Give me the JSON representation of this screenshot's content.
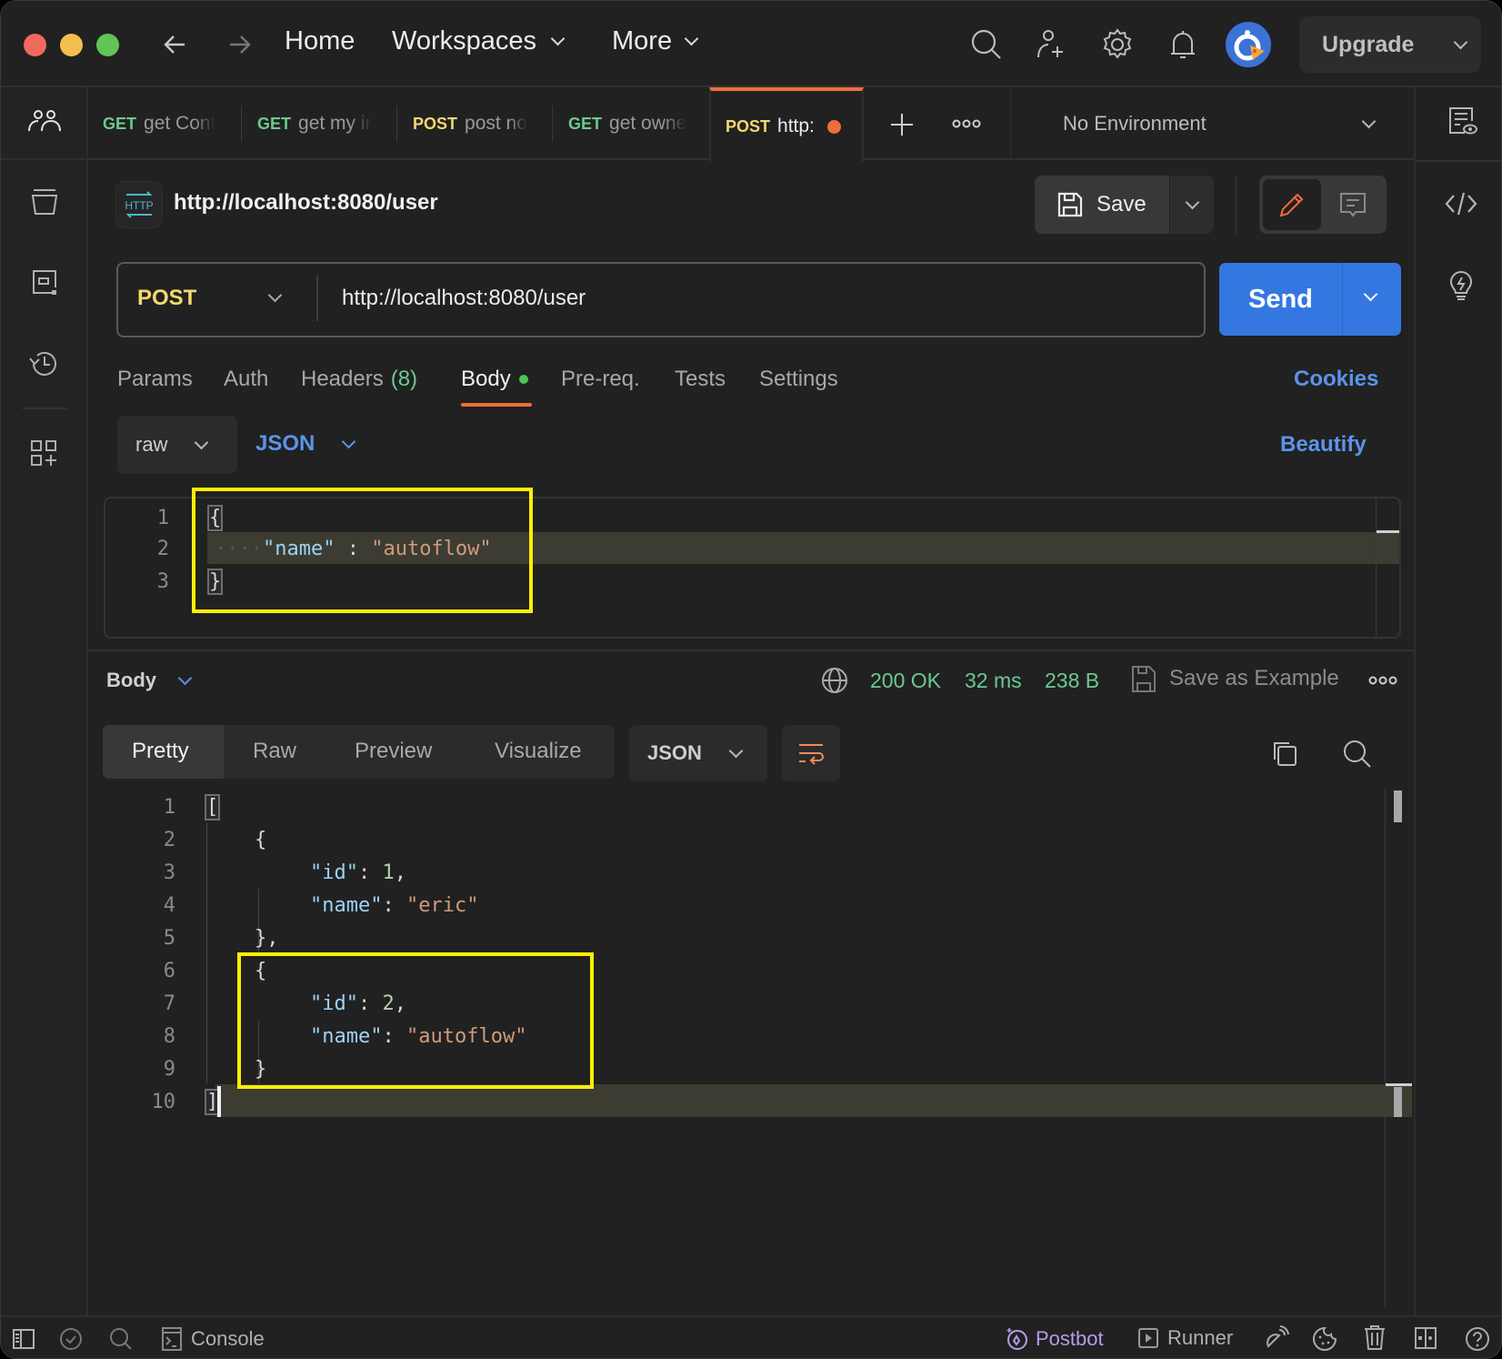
{
  "titlebar": {
    "nav": {
      "home": "Home",
      "workspaces": "Workspaces",
      "more": "More"
    },
    "upgrade_label": "Upgrade",
    "icons": [
      "back-arrow-icon",
      "forward-arrow-icon",
      "search-icon",
      "invite-user-icon",
      "settings-gear-icon",
      "notifications-bell-icon",
      "avatar"
    ]
  },
  "tabs": [
    {
      "method": "GET",
      "title": "get Cont"
    },
    {
      "method": "GET",
      "title": "get my ir"
    },
    {
      "method": "POST",
      "title": "post no"
    },
    {
      "method": "GET",
      "title": "get owne"
    },
    {
      "method": "POST",
      "title": "http:",
      "active": true,
      "unsaved": true
    }
  ],
  "environment": {
    "selected": "No Environment"
  },
  "request": {
    "title": "http://localhost:8080/user",
    "save_label": "Save",
    "method": "POST",
    "url": "http://localhost:8080/user",
    "send_label": "Send",
    "tabs": [
      {
        "label": "Params"
      },
      {
        "label": "Auth"
      },
      {
        "label": "Headers",
        "count": "(8)"
      },
      {
        "label": "Body",
        "active": true
      },
      {
        "label": "Pre-req."
      },
      {
        "label": "Tests"
      },
      {
        "label": "Settings"
      }
    ],
    "cookies_label": "Cookies",
    "body_mode": "raw",
    "body_format": "JSON",
    "beautify_label": "Beautify",
    "body_lines": [
      {
        "n": "1",
        "text": "{"
      },
      {
        "n": "2",
        "key": "\"name\"",
        "sep": " : ",
        "value": "\"autoflow\""
      },
      {
        "n": "3",
        "text": "}"
      }
    ]
  },
  "response": {
    "section_label": "Body",
    "status": "200 OK",
    "time": "32 ms",
    "size": "238 B",
    "save_example_label": "Save as Example",
    "view_tabs": [
      "Pretty",
      "Raw",
      "Preview",
      "Visualize"
    ],
    "active_view": "Pretty",
    "format": "JSON",
    "lines": [
      {
        "n": "1",
        "text": "["
      },
      {
        "n": "2",
        "text": "    {"
      },
      {
        "n": "3",
        "key": "\"id\"",
        "value": "1",
        "type": "num",
        "trail": ","
      },
      {
        "n": "4",
        "key": "\"name\"",
        "value": "\"eric\"",
        "type": "str",
        "trail": ""
      },
      {
        "n": "5",
        "text": "    },"
      },
      {
        "n": "6",
        "text": "    {"
      },
      {
        "n": "7",
        "key": "\"id\"",
        "value": "2",
        "type": "num",
        "trail": ","
      },
      {
        "n": "8",
        "key": "\"name\"",
        "value": "\"autoflow\"",
        "type": "str",
        "trail": ""
      },
      {
        "n": "9",
        "text": "    }"
      },
      {
        "n": "10",
        "text": "]"
      }
    ]
  },
  "statusbar": {
    "console_label": "Console",
    "postbot_label": "Postbot",
    "runner_label": "Runner"
  },
  "colors": {
    "accent_orange": "#ef6c3c",
    "send_blue": "#3577e0",
    "link_blue": "#5b94ea",
    "get_green": "#6cc990",
    "post_yellow": "#f5d86f",
    "postbot_purple": "#b59ce8",
    "highlight_yellow": "#fff000"
  }
}
